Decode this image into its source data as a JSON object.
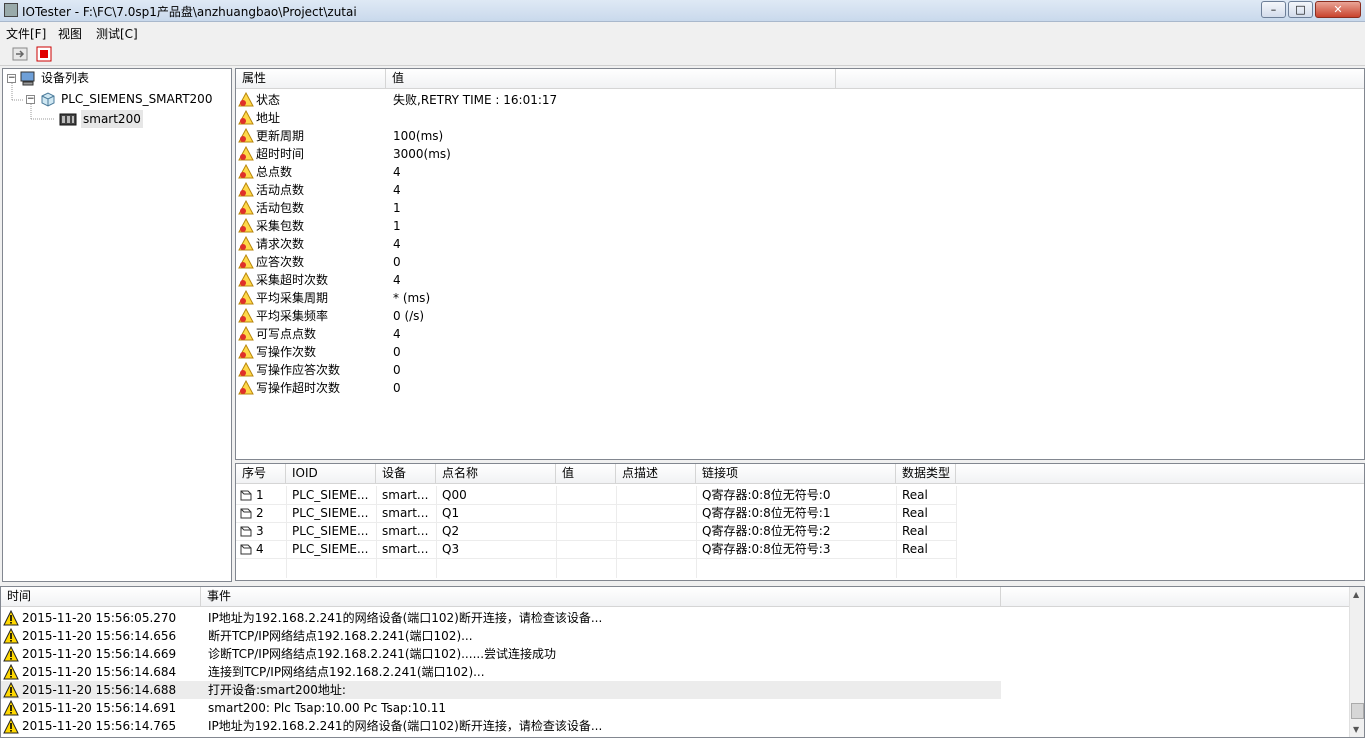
{
  "window": {
    "title": "IOTester - F:\\FC\\7.0sp1产品盘\\anzhuangbao\\Project\\zutai",
    "buttons": [
      "minimize-button",
      "maximize-button",
      "close-button"
    ]
  },
  "menu": {
    "items": [
      {
        "label": "文件[F]"
      },
      {
        "label": "视图"
      },
      {
        "label": "测试[C]"
      }
    ]
  },
  "toolbar": {
    "icons": [
      "run-icon",
      "stop-icon"
    ],
    "stop_color": "#e00000"
  },
  "tree": {
    "root": "设备列表",
    "device": "PLC_SIEMENS_SMART200",
    "child": "smart200"
  },
  "props": {
    "headers": [
      "属性",
      "值"
    ],
    "rows": [
      {
        "name": "状态",
        "value": "失败,RETRY TIME : 16:01:17"
      },
      {
        "name": "地址",
        "value": ""
      },
      {
        "name": "更新周期",
        "value": "100(ms)"
      },
      {
        "name": "超时时间",
        "value": "3000(ms)"
      },
      {
        "name": "总点数",
        "value": "4"
      },
      {
        "name": "活动点数",
        "value": "4"
      },
      {
        "name": "活动包数",
        "value": "1"
      },
      {
        "name": "采集包数",
        "value": "1"
      },
      {
        "name": "请求次数",
        "value": "4"
      },
      {
        "name": "应答次数",
        "value": "0"
      },
      {
        "name": "采集超时次数",
        "value": "4"
      },
      {
        "name": "平均采集周期",
        "value": "* (ms)"
      },
      {
        "name": "平均采集频率",
        "value": "0 (/s)"
      },
      {
        "name": "可写点点数",
        "value": "4"
      },
      {
        "name": "写操作次数",
        "value": "0"
      },
      {
        "name": "写操作应答次数",
        "value": "0"
      },
      {
        "name": "写操作超时次数",
        "value": "0"
      }
    ]
  },
  "points": {
    "headers": [
      "序号",
      "IOID",
      "设备",
      "点名称",
      "值",
      "点描述",
      "链接项",
      "数据类型"
    ],
    "rows": [
      {
        "seq": "1",
        "ioid": "PLC_SIEME...",
        "device": "smart...",
        "name": "Q00",
        "value": "",
        "desc": "",
        "link": "Q寄存器:0:8位无符号:0",
        "type": "Real"
      },
      {
        "seq": "2",
        "ioid": "PLC_SIEME...",
        "device": "smart...",
        "name": "Q1",
        "value": "",
        "desc": "",
        "link": "Q寄存器:0:8位无符号:1",
        "type": "Real"
      },
      {
        "seq": "3",
        "ioid": "PLC_SIEME...",
        "device": "smart...",
        "name": "Q2",
        "value": "",
        "desc": "",
        "link": "Q寄存器:0:8位无符号:2",
        "type": "Real"
      },
      {
        "seq": "4",
        "ioid": "PLC_SIEME...",
        "device": "smart...",
        "name": "Q3",
        "value": "",
        "desc": "",
        "link": "Q寄存器:0:8位无符号:3",
        "type": "Real"
      }
    ]
  },
  "log": {
    "headers": [
      "时间",
      "事件"
    ],
    "rows": [
      {
        "time": "2015-11-20 15:56:05.270",
        "event": "IP地址为192.168.2.241的网络设备(端口102)断开连接，请检查该设备..."
      },
      {
        "time": "2015-11-20 15:56:14.656",
        "event": "断开TCP/IP网络结点192.168.2.241(端口102)..."
      },
      {
        "time": "2015-11-20 15:56:14.669",
        "event": "诊断TCP/IP网络结点192.168.2.241(端口102)......尝试连接成功"
      },
      {
        "time": "2015-11-20 15:56:14.684",
        "event": "连接到TCP/IP网络结点192.168.2.241(端口102)..."
      },
      {
        "time": "2015-11-20 15:56:14.688",
        "event": "打开设备:smart200地址:"
      },
      {
        "time": "2015-11-20 15:56:14.691",
        "event": "smart200: Plc Tsap:10.00 Pc Tsap:10.11"
      },
      {
        "time": "2015-11-20 15:56:14.765",
        "event": "IP地址为192.168.2.241的网络设备(端口102)断开连接，请检查该设备..."
      }
    ]
  }
}
